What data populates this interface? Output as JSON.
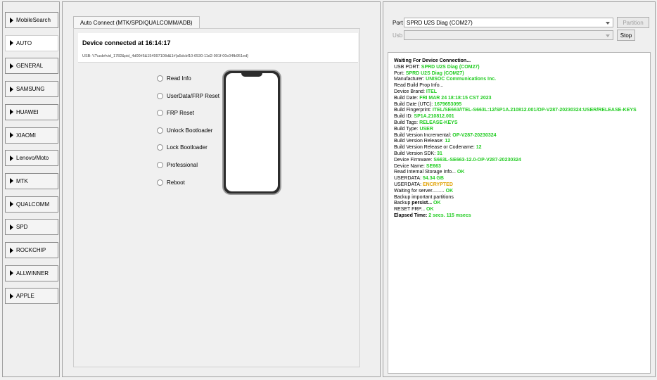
{
  "categories": [
    {
      "label": "MobileSearch"
    },
    {
      "label": "AUTO",
      "active": true
    },
    {
      "label": "GENERAL"
    },
    {
      "label": "SAMSUNG"
    },
    {
      "label": "HUAWEI"
    },
    {
      "label": "XIAOMI"
    },
    {
      "label": "Lenovo/Moto"
    },
    {
      "label": "MTK"
    },
    {
      "label": "QUALCOMM"
    },
    {
      "label": "SPD"
    },
    {
      "label": "ROCKCHIP"
    },
    {
      "label": "ALLWINNER"
    },
    {
      "label": "APPLE"
    }
  ],
  "main": {
    "tab_label": "Auto Connect (MTK/SPD/QUALCOMM/ADB)",
    "device_title": "Device connected at 16:14:17",
    "device_usb": "USB: \\\\?\\usb#vid_1782&pid_4d00#5&154997108d&1#{a5dcbf10-6530-11d2-901f-00c04fb951ed}",
    "options": [
      "Read Info",
      "UserData/FRP Reset",
      "FRP Reset",
      "Unlock Bootloader",
      "Lock Bootloader",
      "Professional",
      "Reboot"
    ]
  },
  "right": {
    "port_label": "Port",
    "port_value": "SPRD U2S Diag (COM27)",
    "usb_label": "Usb",
    "usb_value": "",
    "partition_button": "Partition",
    "stop_button": "Stop"
  },
  "log": [
    {
      "k": "Waiting For Device Connection...",
      "v": "",
      "bold": true
    },
    {
      "k": "USB PORT: ",
      "v": "SPRD U2S Diag (COM27)"
    },
    {
      "k": "Port: ",
      "v": "SPRD U2S Diag (COM27)"
    },
    {
      "k": "Manufacturer: ",
      "v": "UNISOC Communications Inc."
    },
    {
      "k": "Read Build Prop Info...",
      "v": ""
    },
    {
      "k": " Device Brand: ",
      "v": "ITEL"
    },
    {
      "k": " Build Date: ",
      "v": "FRI MAR 24 18:18:15 CST 2023"
    },
    {
      "k": " Build Date (UTC): ",
      "v": "1679653095"
    },
    {
      "k": " Build Fingerprint: ",
      "v": "ITEL/SE663/ITEL-S663L:12/SP1A.210812.001/OP-V287-20230324:USER/RELEASE-KEYS"
    },
    {
      "k": " Build ID: ",
      "v": "SP1A.210812.001"
    },
    {
      "k": " Build Tags: ",
      "v": "RELEASE-KEYS"
    },
    {
      "k": " Build Type: ",
      "v": "USER"
    },
    {
      "k": " Build Version Incremental: ",
      "v": "OP-V287-20230324"
    },
    {
      "k": " Build Version Release: ",
      "v": "12"
    },
    {
      "k": " Build Version Release or Codename: ",
      "v": "12"
    },
    {
      "k": " Build Version SDK: ",
      "v": "31"
    },
    {
      "k": " Device Firmware: ",
      "v": "S663L-SE663-12.0-OP-V287-20230324"
    },
    {
      "k": " Device Name: ",
      "v": "SE663"
    },
    {
      "k": "Read Internal Storage Info... ",
      "v": "OK"
    },
    {
      "k": "USERDATA: ",
      "v": "54.34 GB"
    },
    {
      "k": "USERDATA: ",
      "v": "ENCRYPTED",
      "enc": true
    },
    {
      "k": "Waiting for server......... ",
      "v": "OK"
    },
    {
      "k": "Backup important partitions",
      "v": ""
    },
    {
      "k": "  Backup ",
      "v": "OK",
      "mid": "persist... "
    },
    {
      "k": "RESET FRP... ",
      "v": "OK"
    },
    {
      "k": "Elapsed Time: ",
      "v": "2 secs. 115 msecs",
      "bold": true
    }
  ]
}
